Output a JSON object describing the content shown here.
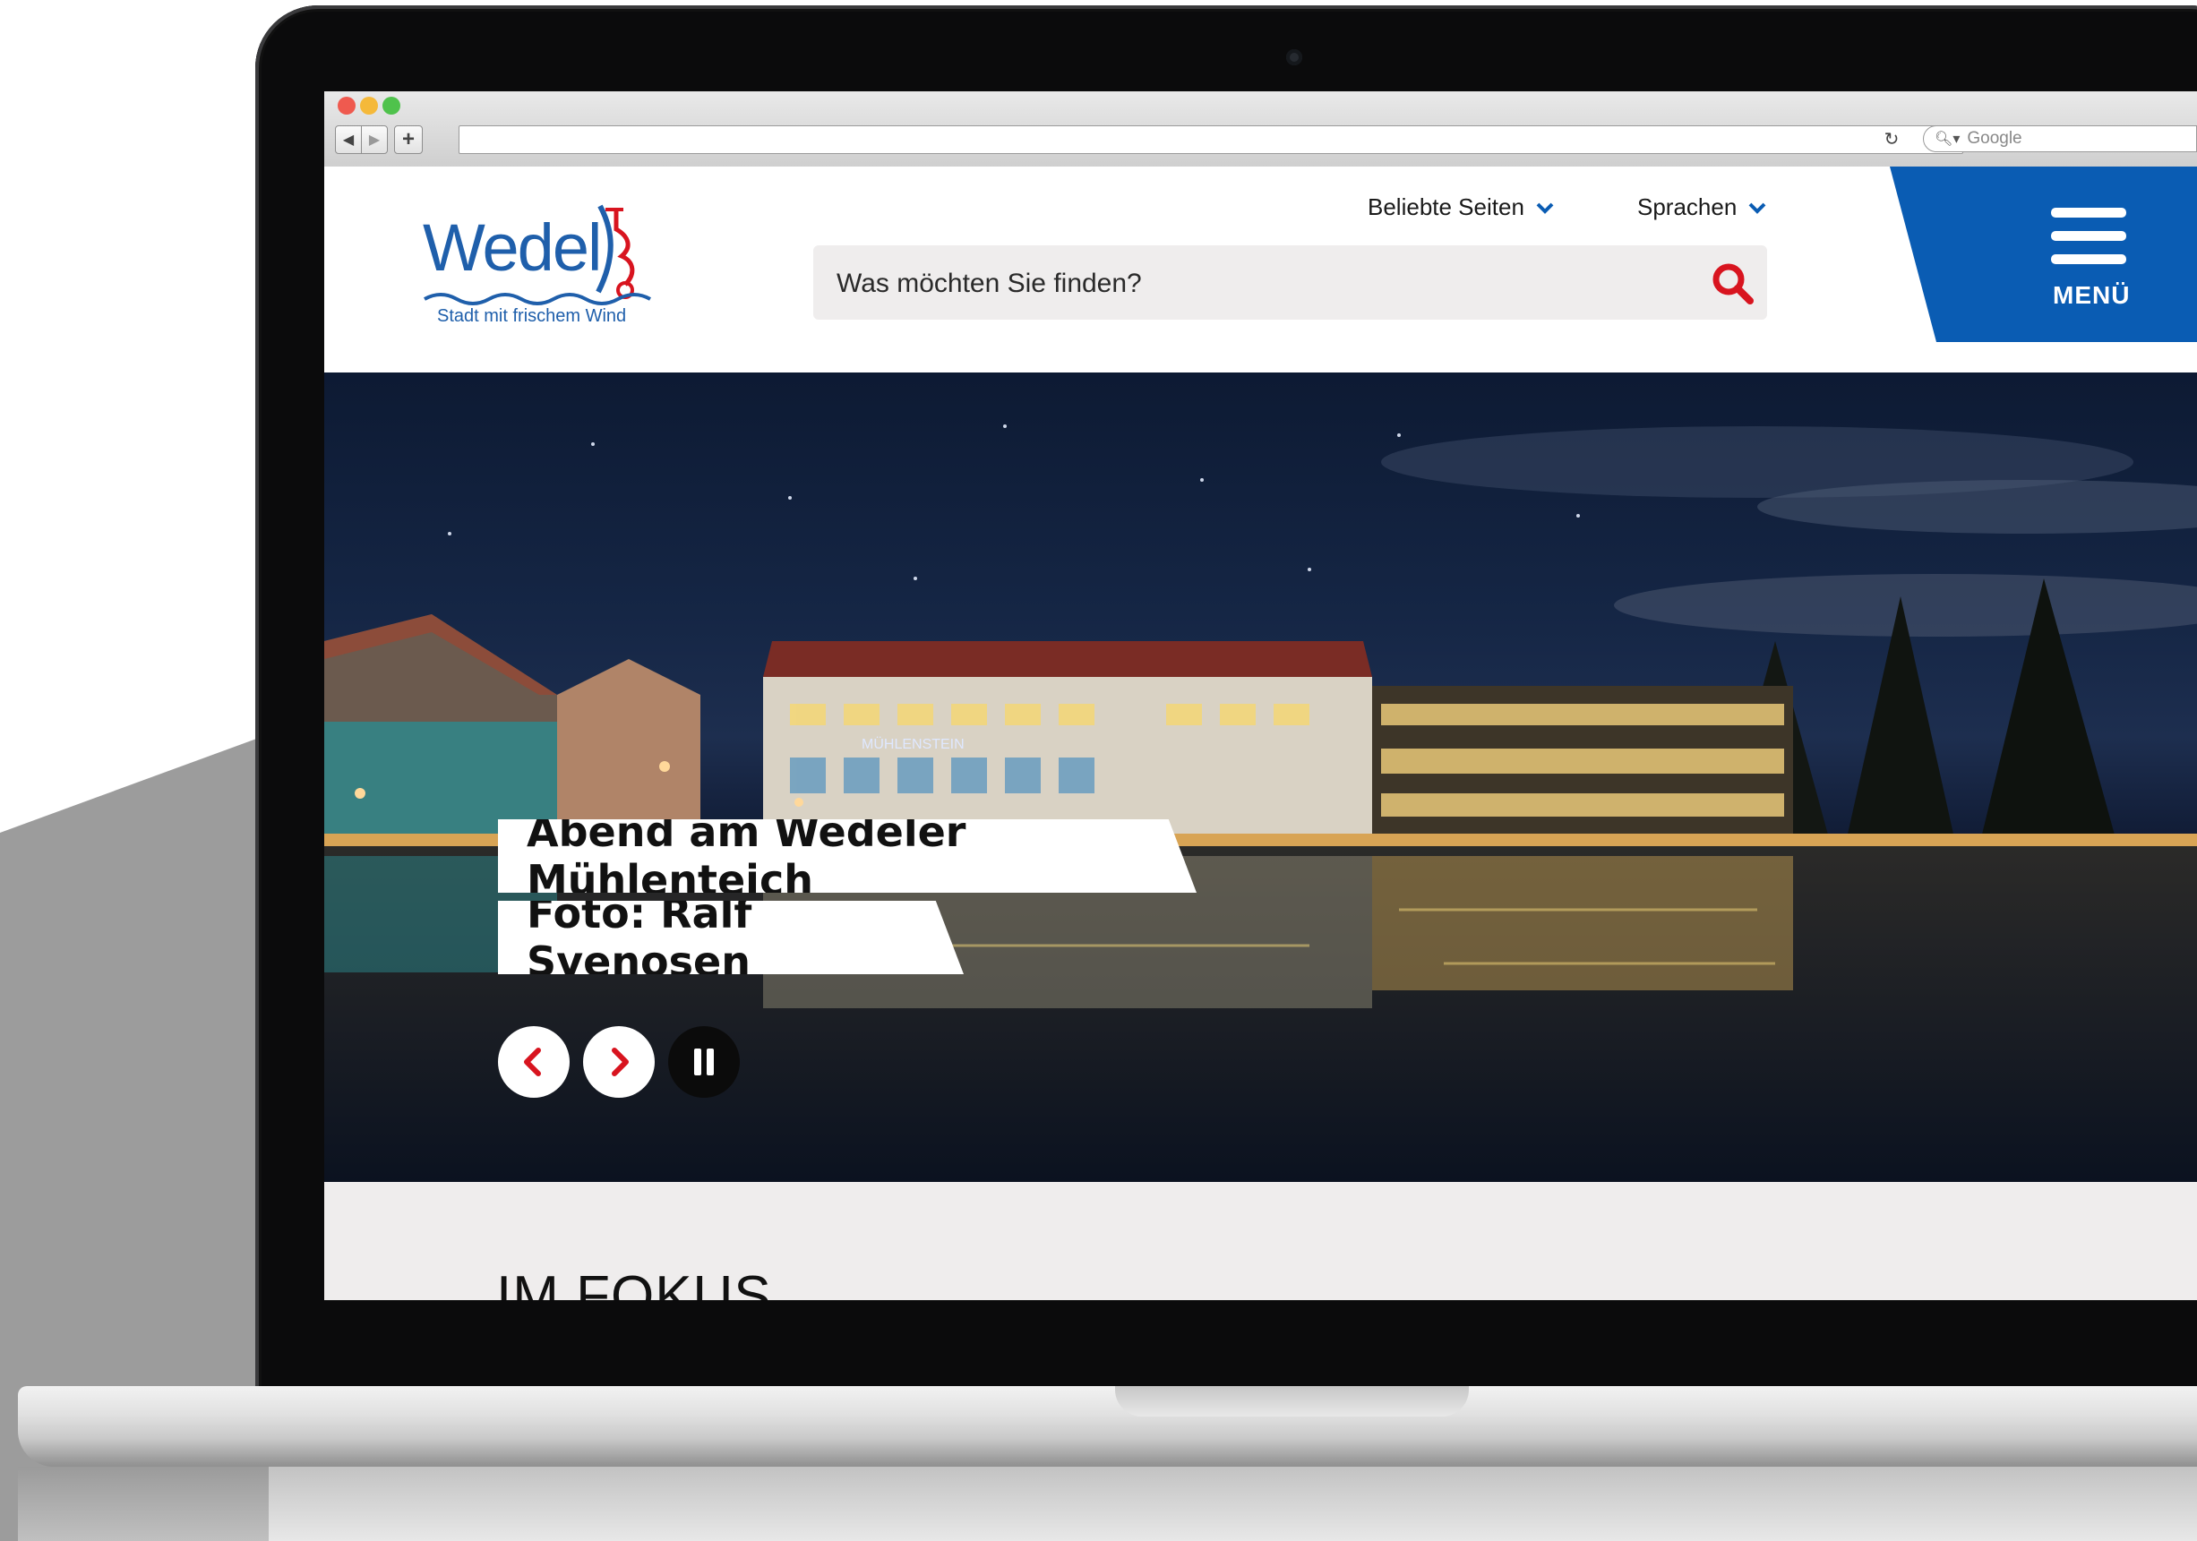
{
  "browser": {
    "search_placeholder": "Google"
  },
  "site": {
    "logo_text": "Wedel",
    "logo_tagline": "Stadt mit frischem Wind",
    "top_links": [
      {
        "label": "Beliebte Seiten"
      },
      {
        "label": "Sprachen"
      }
    ],
    "search_placeholder": "Was möchten Sie finden?",
    "menu_label": "MENÜ"
  },
  "hero": {
    "caption_title": "Abend am Wedeler Mühlenteich",
    "caption_credit": "Foto: Ralf Svenosen",
    "sign_text": "MÜHLENSTEIN"
  },
  "focus": {
    "title": "IM FOKUS"
  },
  "colors": {
    "brand_blue": "#1f5fab",
    "menu_blue": "#0a5cb3",
    "accent_red": "#d8141f",
    "search_bg": "#efeded"
  }
}
